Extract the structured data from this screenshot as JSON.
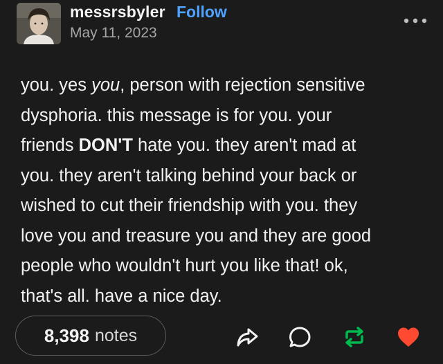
{
  "post": {
    "username": "messrsbyler",
    "follow_label": "Follow",
    "date": "May 11, 2023",
    "body": {
      "l1a": "you. yes ",
      "l1b": "you",
      "l1c": ", person with rejection sensitive",
      "l2": "dysphoria. this message is for you. your",
      "l3a": "friends ",
      "l3b": "DON'T",
      "l3c": " hate you. they aren't mad at",
      "l4": "you. they aren't talking behind your back or",
      "l5": "wished to cut their friendship with you. they",
      "l6": "love you and treasure you and they are good",
      "l7": "people who wouldn't hurt you like that! ok,",
      "l8": "that's all. have a nice day."
    }
  },
  "footer": {
    "notes_count": "8,398",
    "notes_label": "notes"
  },
  "icons": {
    "more": "more-dots-icon",
    "share": "share-icon",
    "reply": "reply-icon",
    "reblog": "reblog-icon",
    "like": "heart-icon"
  },
  "colors": {
    "background": "#1b1b1b",
    "follow": "#4fa3ff",
    "reblog": "#00b84d",
    "like": "#ff4930"
  }
}
